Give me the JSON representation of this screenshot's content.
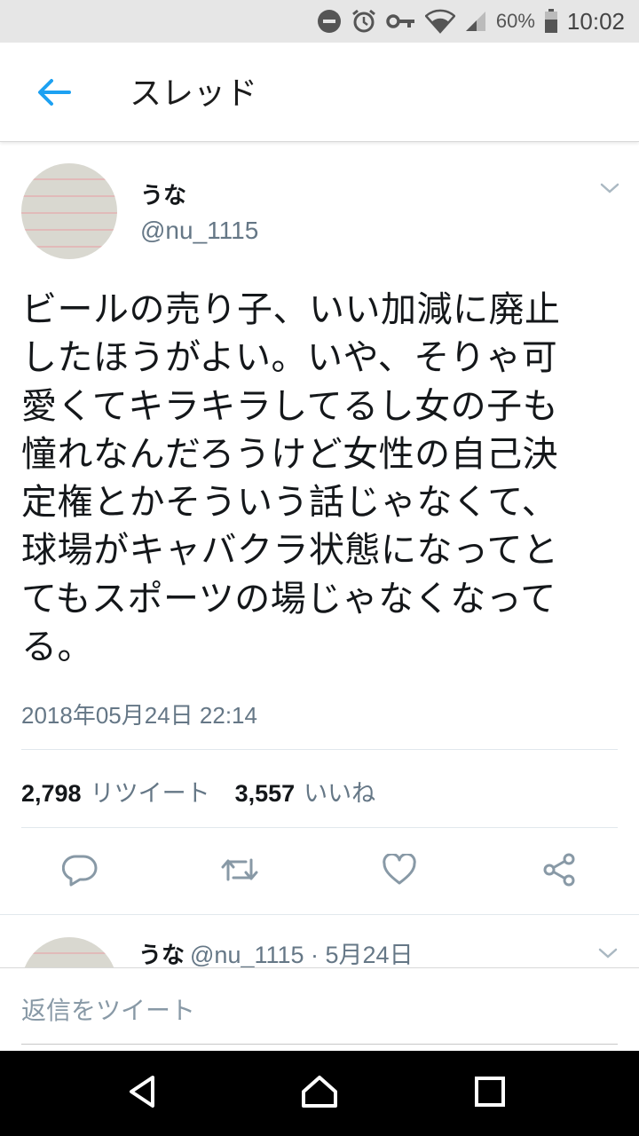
{
  "status_bar": {
    "battery_text": "60%",
    "time": "10:02",
    "icons": [
      "do-not-disturb-icon",
      "alarm-icon",
      "vpn-key-icon",
      "wifi-icon",
      "signal-icon",
      "battery-icon"
    ]
  },
  "app_bar": {
    "back_icon": "arrow-left-icon",
    "title": "スレッド"
  },
  "tweet": {
    "display_name": "うな",
    "handle": "@nu_1115",
    "text": "ビールの売り子、いい加減に廃止\nしたほうがよい。いや、そりゃ可\n愛くてキラキラしてるし女の子も\n憧れなんだろうけど女性の自己決\n定権とかそういう話じゃなくて、\n球場がキャバクラ状態になってと\nてもスポーツの場じゃなくなって\nる。",
    "timestamp": "2018年05月24日 22:14",
    "retweet_count": "2,798",
    "retweet_label": "リツイート",
    "like_count": "3,557",
    "like_label": "いいね",
    "actions": [
      "reply-icon",
      "retweet-icon",
      "like-icon",
      "share-icon"
    ]
  },
  "reply_preview": {
    "display_name": "うな",
    "meta": "@nu_1115 · 5月24日"
  },
  "compose": {
    "placeholder": "返信をツイート"
  },
  "nav_bar": {
    "buttons": [
      "back-triangle-icon",
      "home-icon",
      "recents-icon"
    ]
  },
  "colors": {
    "accent": "#1da1f2",
    "secondary_text": "#657786",
    "icon_gray": "#8899a6"
  }
}
